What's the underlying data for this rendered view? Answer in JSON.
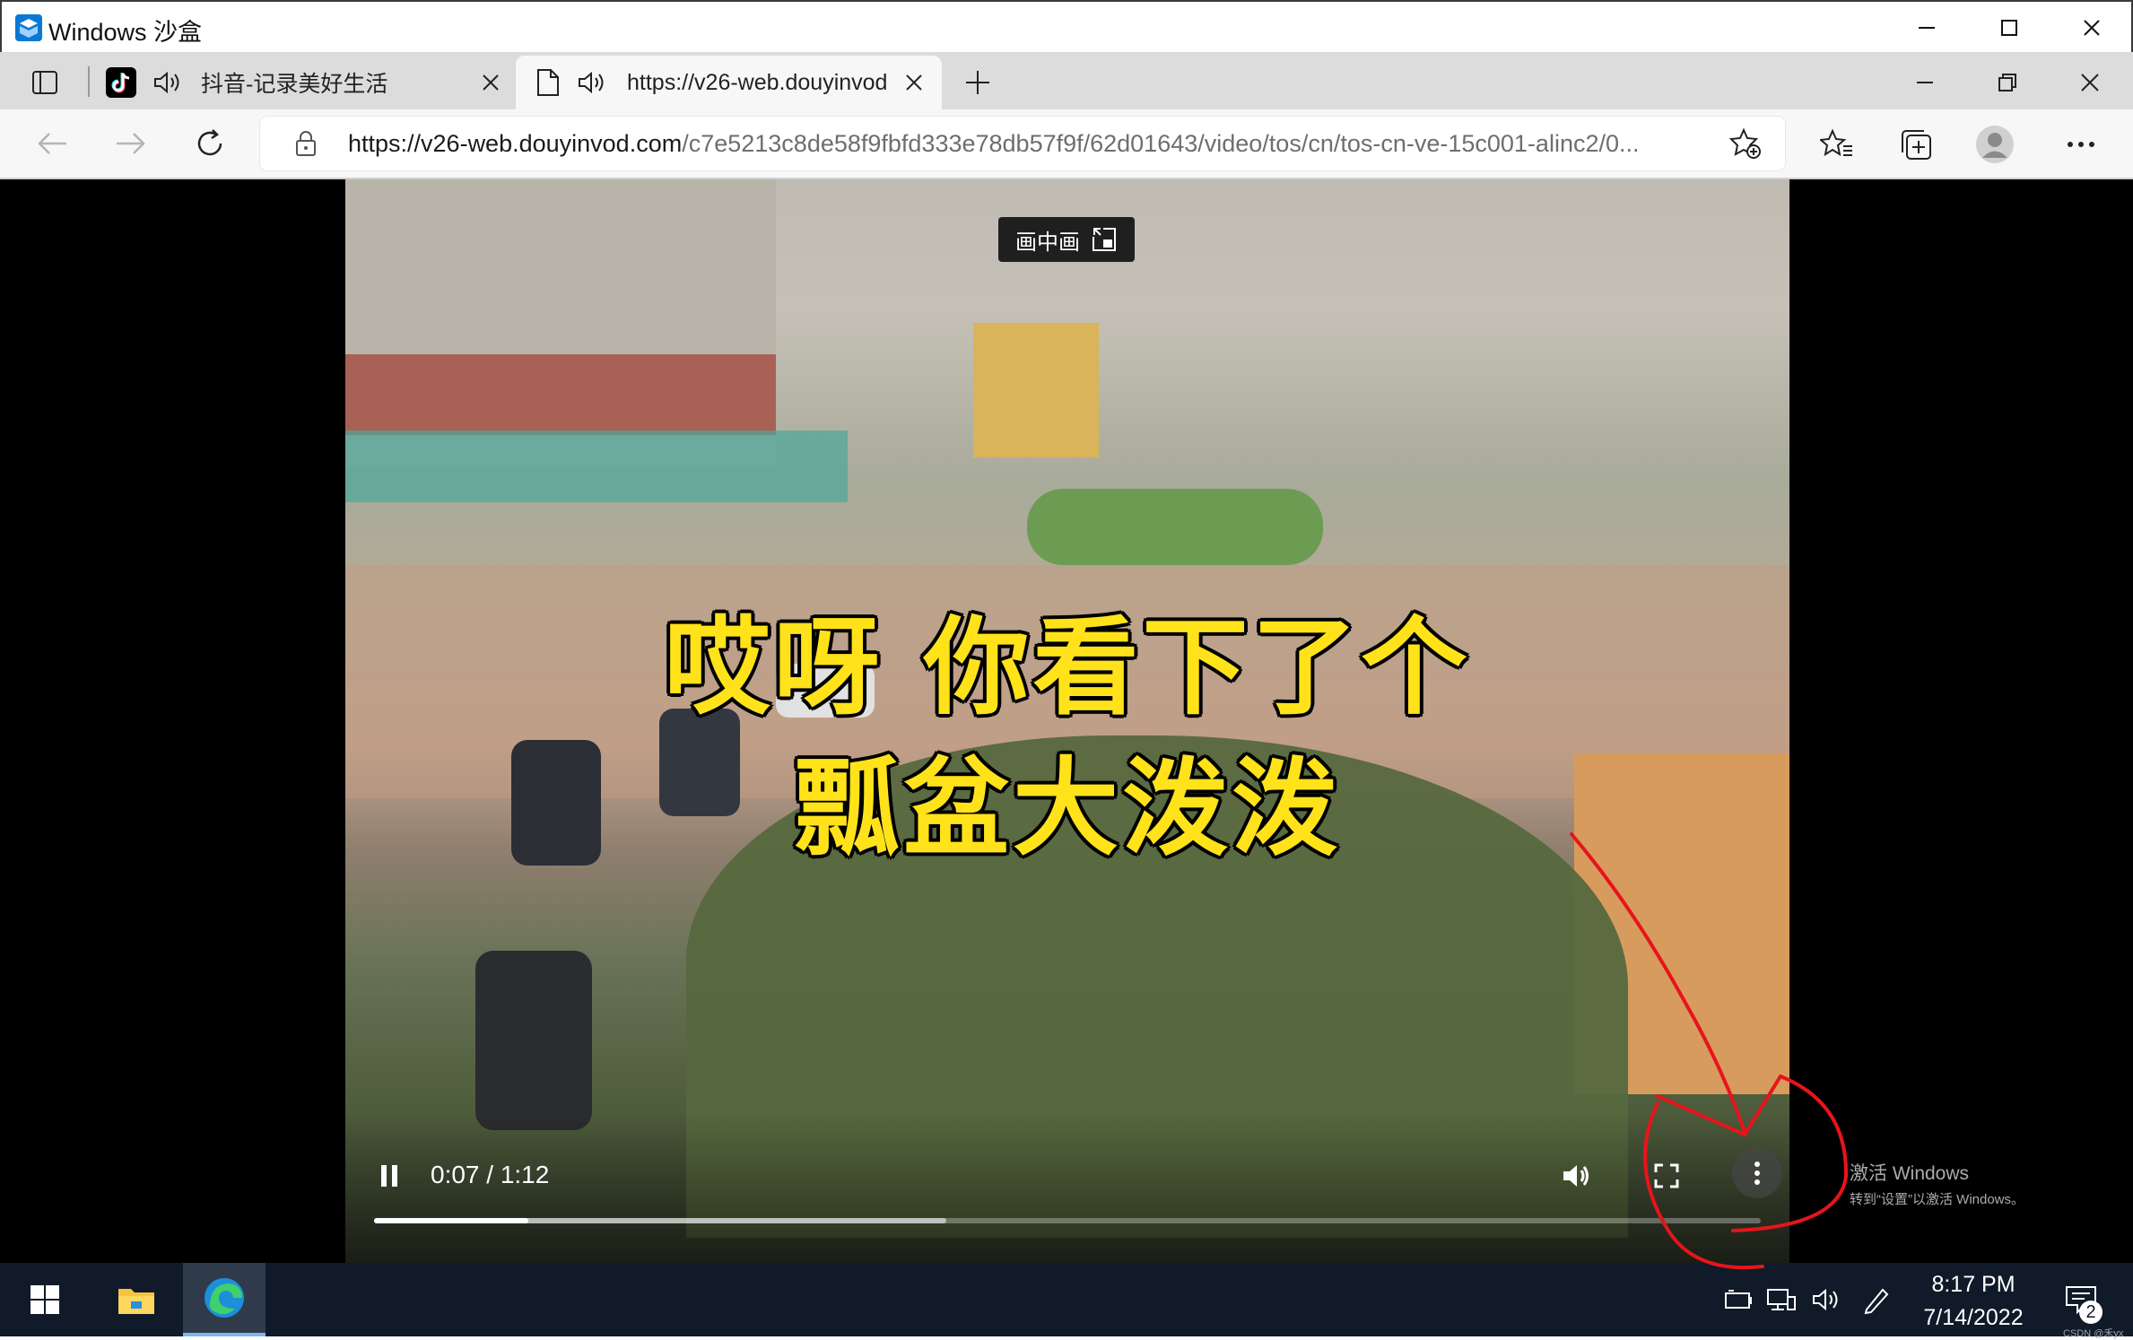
{
  "window": {
    "title": "Windows 沙盒",
    "controls": [
      "minimize",
      "maximize",
      "close"
    ]
  },
  "tabs": [
    {
      "label": "抖音-记录美好生活",
      "icon": "tiktok-icon",
      "audio": true,
      "active": false
    },
    {
      "label": "https://v26-web.douyinvod.",
      "icon": "page-icon",
      "audio": true,
      "active": true
    }
  ],
  "address_bar": {
    "url_host": "https://v26-web.douyinvod.com",
    "url_path": "/c7e5213c8de58f9fbfd333e78db57f9f/62d01643/video/tos/cn/tos-cn-ve-15c001-alinc2/0..."
  },
  "video": {
    "pip_label": "画中画",
    "caption_line1": "哎呀 你看下了个",
    "caption_line2": "瓢盆大泼泼",
    "time_display": "0:07 / 1:12",
    "played_fraction": 0.111,
    "buffered_fraction": 0.413
  },
  "watermark": {
    "line1": "激活 Windows",
    "line2": "转到“设置”以激活 Windows。"
  },
  "taskbar": {
    "time": "8:17 PM",
    "date": "7/14/2022",
    "notification_count": "2",
    "corner_text": "CSDN @禾yx"
  },
  "colors": {
    "caption_yellow": "#ffe21a",
    "taskbar_bg": "#101a28",
    "annotation_red": "#e8141b"
  }
}
